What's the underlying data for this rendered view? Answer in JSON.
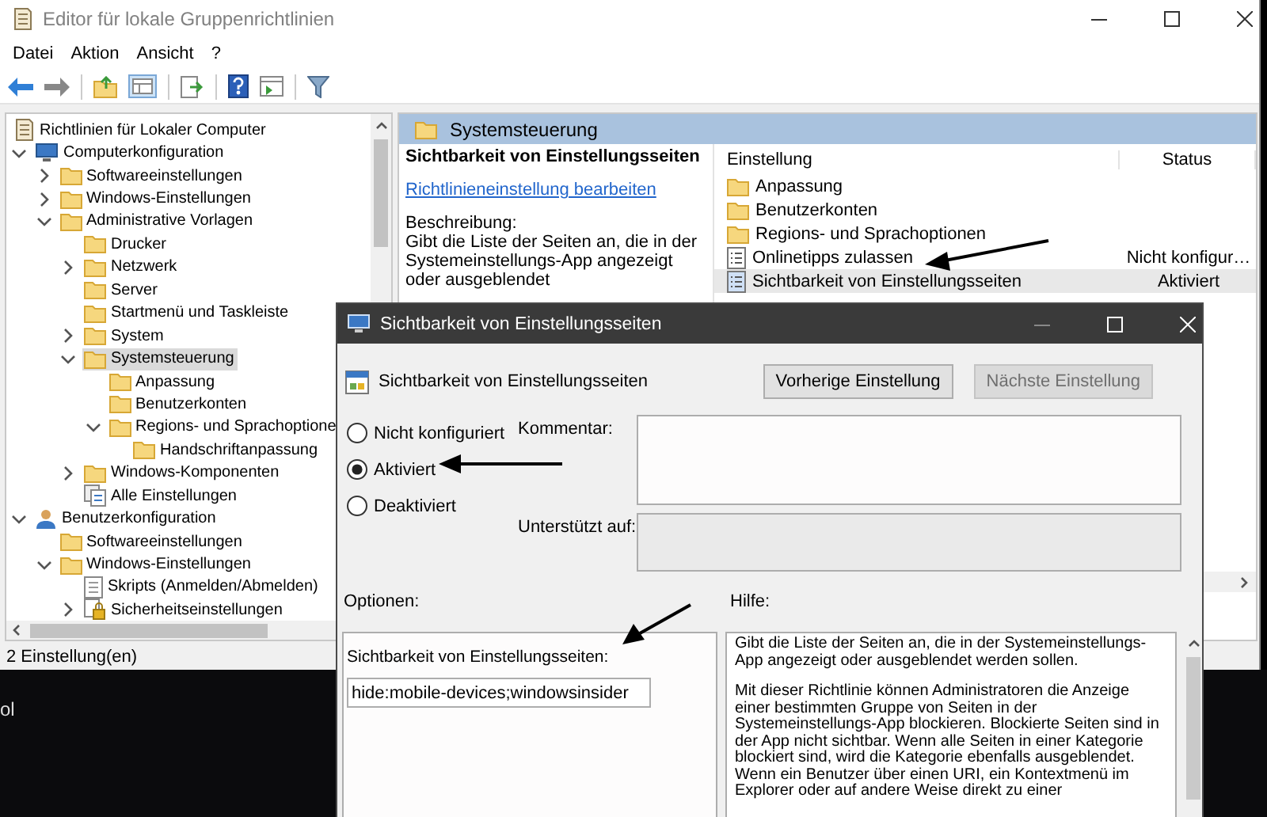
{
  "window": {
    "title": "Editor für lokale Gruppenrichtlinien",
    "menu": [
      "Datei",
      "Aktion",
      "Ansicht",
      "?"
    ]
  },
  "tree": {
    "label": "Richtlinien für Lokaler Computer",
    "kind": "policy",
    "selected": false,
    "children": [
      {
        "label": "Computerkonfiguration",
        "kind": "computer",
        "expanded": true,
        "selected": false,
        "children": [
          {
            "label": "Softwareeinstellungen",
            "kind": "folder",
            "expanded": false,
            "selected": false
          },
          {
            "label": "Windows-Einstellungen",
            "kind": "folder",
            "expanded": false,
            "selected": false
          },
          {
            "label": "Administrative Vorlagen",
            "kind": "folder",
            "expanded": true,
            "selected": false,
            "children": [
              {
                "label": "Drucker",
                "kind": "folder",
                "selected": false
              },
              {
                "label": "Netzwerk",
                "kind": "folder",
                "expanded": false,
                "selected": false
              },
              {
                "label": "Server",
                "kind": "folder",
                "selected": false
              },
              {
                "label": "Startmenü und Taskleiste",
                "kind": "folder",
                "selected": false
              },
              {
                "label": "System",
                "kind": "folder",
                "expanded": false,
                "selected": false
              },
              {
                "label": "Systemsteuerung",
                "kind": "folder",
                "expanded": true,
                "selected": true,
                "children": [
                  {
                    "label": "Anpassung",
                    "kind": "folder",
                    "selected": false
                  },
                  {
                    "label": "Benutzerkonten",
                    "kind": "folder",
                    "selected": false
                  },
                  {
                    "label": "Regions- und Sprachoptione",
                    "kind": "folder",
                    "expanded": true,
                    "selected": false,
                    "children": [
                      {
                        "label": "Handschriftanpassung",
                        "kind": "folder",
                        "selected": false
                      }
                    ]
                  }
                ]
              },
              {
                "label": "Windows-Komponenten",
                "kind": "folder",
                "expanded": false,
                "selected": false
              },
              {
                "label": "Alle Einstellungen",
                "kind": "all-settings",
                "selected": false
              }
            ]
          }
        ]
      },
      {
        "label": "Benutzerkonfiguration",
        "kind": "user",
        "expanded": true,
        "selected": false,
        "children": [
          {
            "label": "Softwareeinstellungen",
            "kind": "folder",
            "selected": false
          },
          {
            "label": "Windows-Einstellungen",
            "kind": "folder",
            "expanded": true,
            "selected": false,
            "children": [
              {
                "label": "Skripts (Anmelden/Abmelden)",
                "kind": "script",
                "selected": false
              },
              {
                "label": "Sicherheitseinstellungen",
                "kind": "security",
                "expanded": false,
                "selected": false
              }
            ]
          }
        ]
      }
    ]
  },
  "header": {
    "title": "Systemsteuerung"
  },
  "details": {
    "title": "Sichtbarkeit von Einstellungsseiten",
    "link": "Richtlinieneinstellung bearbeiten",
    "description_label": "Beschreibung:",
    "description": "Gibt die Liste der Seiten an, die in der Systemeinstellungs-App angezeigt oder ausgeblendet"
  },
  "table": {
    "columns": [
      "Einstellung",
      "Status"
    ],
    "rows": [
      {
        "kind": "folder",
        "name": "Anpassung",
        "selected": false
      },
      {
        "kind": "folder",
        "name": "Benutzerkonten",
        "selected": false
      },
      {
        "kind": "folder",
        "name": "Regions- und Sprachoptionen",
        "selected": false
      },
      {
        "kind": "setting",
        "name": "Onlinetipps zulassen",
        "status": "Nicht konfigur…",
        "selected": false
      },
      {
        "kind": "setting",
        "name": "Sichtbarkeit von Einstellungsseiten",
        "status": "Aktiviert",
        "selected": true
      }
    ]
  },
  "status_bar": "2 Einstellung(en)",
  "desktop": {
    "text": "ol"
  },
  "dialog": {
    "title": "Sichtbarkeit von Einstellungsseiten",
    "heading": "Sichtbarkeit von Einstellungsseiten",
    "buttons": [
      {
        "label": "Vorherige Einstellung",
        "disabled": false
      },
      {
        "label": "Nächste Einstellung",
        "disabled": true
      }
    ],
    "state_options": [
      {
        "label": "Nicht konfiguriert",
        "selected": false
      },
      {
        "label": "Aktiviert",
        "selected": true
      },
      {
        "label": "Deaktiviert",
        "selected": false
      }
    ],
    "comment": {
      "label": "Kommentar:",
      "disabled": false
    },
    "supported_on": {
      "label": "Unterstützt auf:",
      "disabled": true
    },
    "options_label": "Optionen:",
    "help_label": "Hilfe:",
    "option_field": {
      "label": "Sichtbarkeit von Einstellungsseiten:",
      "value": "hide:mobile-devices;windowsinsider"
    },
    "help": [
      "Gibt die Liste der Seiten an, die in der Systemeinstellungs-App angezeigt oder ausgeblendet werden sollen.",
      "Mit dieser Richtlinie können Administratoren die Anzeige einer bestimmten Gruppe von Seiten in der Systemeinstellungs-App blockieren. Blockierte Seiten sind in der App nicht sichtbar. Wenn alle Seiten in einer Kategorie blockiert sind, wird die Kategorie ebenfalls ausgeblendet. Wenn ein Benutzer über einen URI, ein Kontextmenü im Explorer oder auf andere Weise direkt zu einer"
    ]
  }
}
